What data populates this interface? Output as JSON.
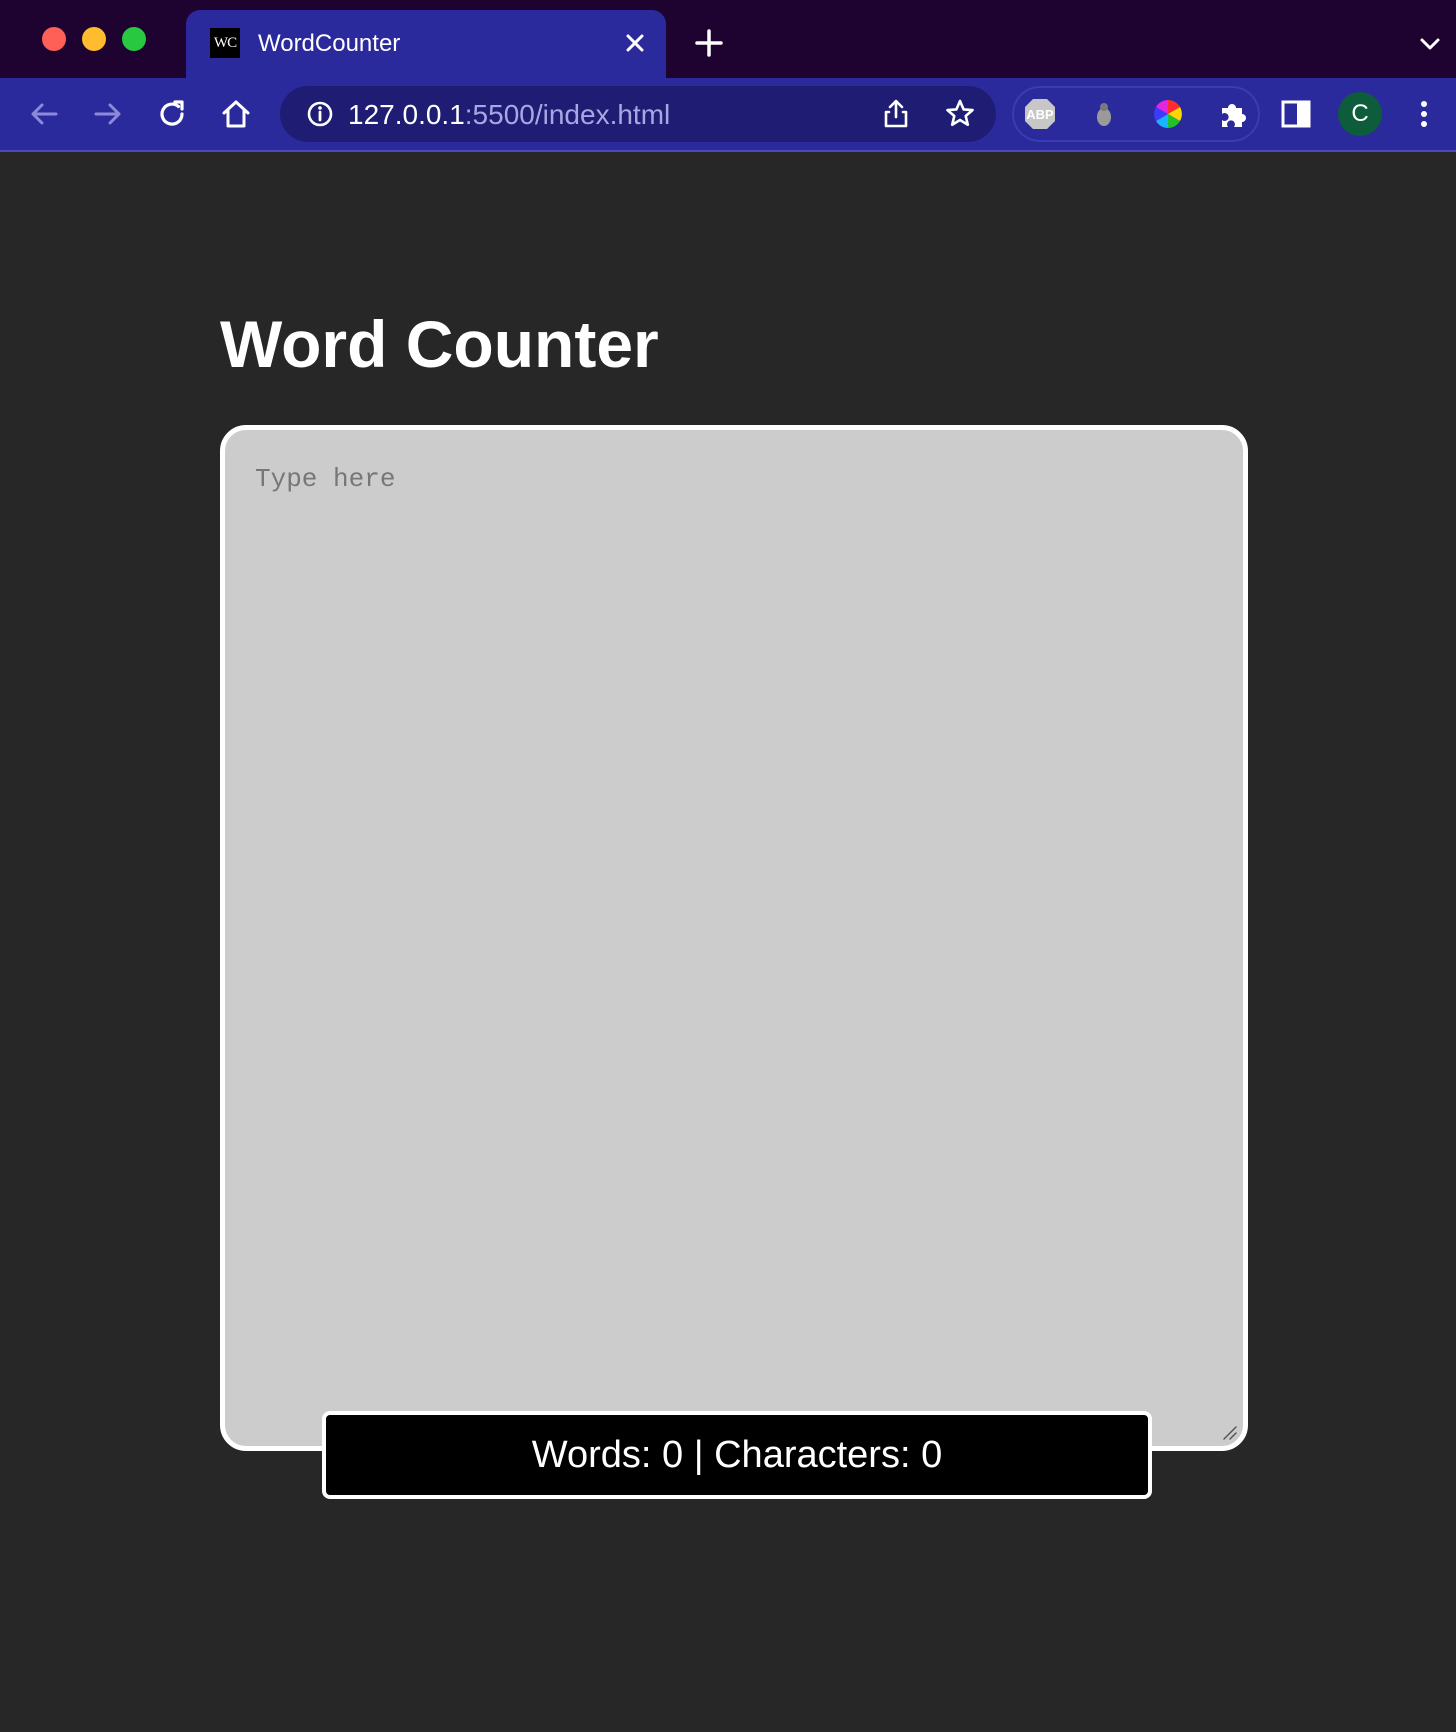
{
  "browser": {
    "tab": {
      "favicon_text": "WC",
      "title": "WordCounter"
    },
    "url": {
      "host": "127.0.0.1",
      "rest": ":5500/index.html"
    },
    "extensions": [
      "adblock-plus-icon",
      "ladybug-icon",
      "color-wheel-icon",
      "puzzle-icon"
    ],
    "profile_initial": "C",
    "colors": {
      "tabbar_bg": "#1e0330",
      "toolbar_bg": "#2b2a9c",
      "omnibox_bg": "#1e1c73",
      "avatar_bg": "#0d5c3b"
    }
  },
  "page": {
    "title": "Word Counter",
    "textarea": {
      "placeholder": "Type here",
      "value": ""
    },
    "counter": {
      "text": "Words: 0 | Characters: 0"
    },
    "colors": {
      "page_bg": "#272727",
      "textarea_bg": "#cccccc",
      "counter_bg": "#000000",
      "accent": "#ffffff"
    }
  }
}
